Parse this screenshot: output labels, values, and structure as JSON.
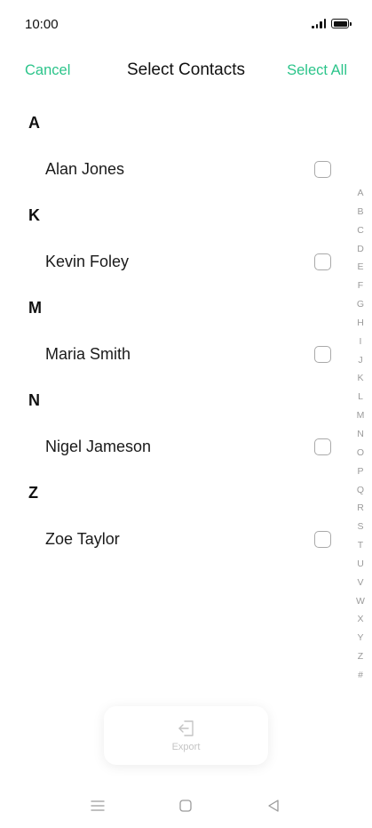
{
  "status_bar": {
    "time": "10:00"
  },
  "nav": {
    "cancel_label": "Cancel",
    "title": "Select Contacts",
    "select_all_label": "Select All"
  },
  "groups": [
    {
      "letter": "A",
      "contacts": [
        "Alan Jones"
      ]
    },
    {
      "letter": "K",
      "contacts": [
        "Kevin Foley"
      ]
    },
    {
      "letter": "M",
      "contacts": [
        "Maria Smith"
      ]
    },
    {
      "letter": "N",
      "contacts": [
        "Nigel Jameson"
      ]
    },
    {
      "letter": "Z",
      "contacts": [
        "Zoe Taylor"
      ]
    }
  ],
  "index_letters": [
    "A",
    "B",
    "C",
    "D",
    "E",
    "F",
    "G",
    "H",
    "I",
    "J",
    "K",
    "L",
    "M",
    "N",
    "O",
    "P",
    "Q",
    "R",
    "S",
    "T",
    "U",
    "V",
    "W",
    "X",
    "Y",
    "Z",
    "#"
  ],
  "export": {
    "label": "Export",
    "icon": "export-icon"
  },
  "colors": {
    "accent": "#2bc48a",
    "disabled": "#c4c4c4",
    "index": "#9a9a9a"
  }
}
